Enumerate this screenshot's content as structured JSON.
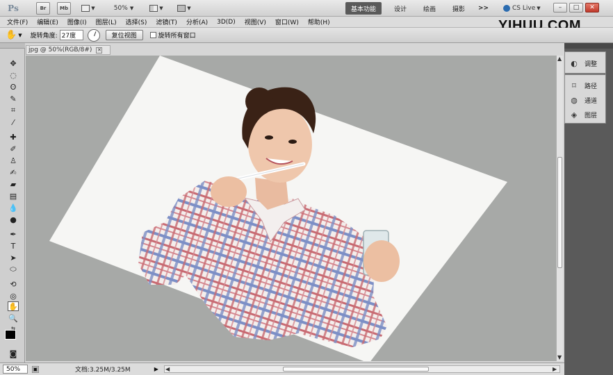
{
  "app": {
    "logo": "Ps",
    "bridge_btn": "Br",
    "minibridge_btn": "Mb",
    "zoom_level": "50%",
    "workspaces": [
      "基本功能",
      "设计",
      "绘画",
      "摄影"
    ],
    "more": ">>",
    "cs_live": "CS Live",
    "window_controls": [
      "–",
      "□",
      "✕"
    ]
  },
  "menu": [
    "文件(F)",
    "编辑(E)",
    "图像(I)",
    "图层(L)",
    "选择(S)",
    "滤镜(T)",
    "分析(A)",
    "3D(D)",
    "视图(V)",
    "窗口(W)",
    "帮助(H)"
  ],
  "watermark": "YIHUU.COM",
  "options": {
    "rotate_label": "旋转角度:",
    "rotate_value": "27度",
    "reset_view": "复位视图",
    "rotate_all_label": "旋转所有窗口"
  },
  "document": {
    "tab_title": "jpg @ 50%(RGB/8#)",
    "tab_close": "✕"
  },
  "status": {
    "zoom": "50%",
    "doc_info": "文档:3.25M/3.25M"
  },
  "panels": {
    "adjustments": "调整",
    "paths": "路径",
    "channels": "通道",
    "layers": "图层"
  },
  "icons": {
    "rotate_view_tool": "rotate-view-icon",
    "move": "move-icon",
    "marquee": "marquee-icon",
    "lasso": "lasso-icon",
    "quick_select": "quick-select-icon",
    "crop": "crop-icon",
    "eyedropper": "eyedropper-icon"
  }
}
